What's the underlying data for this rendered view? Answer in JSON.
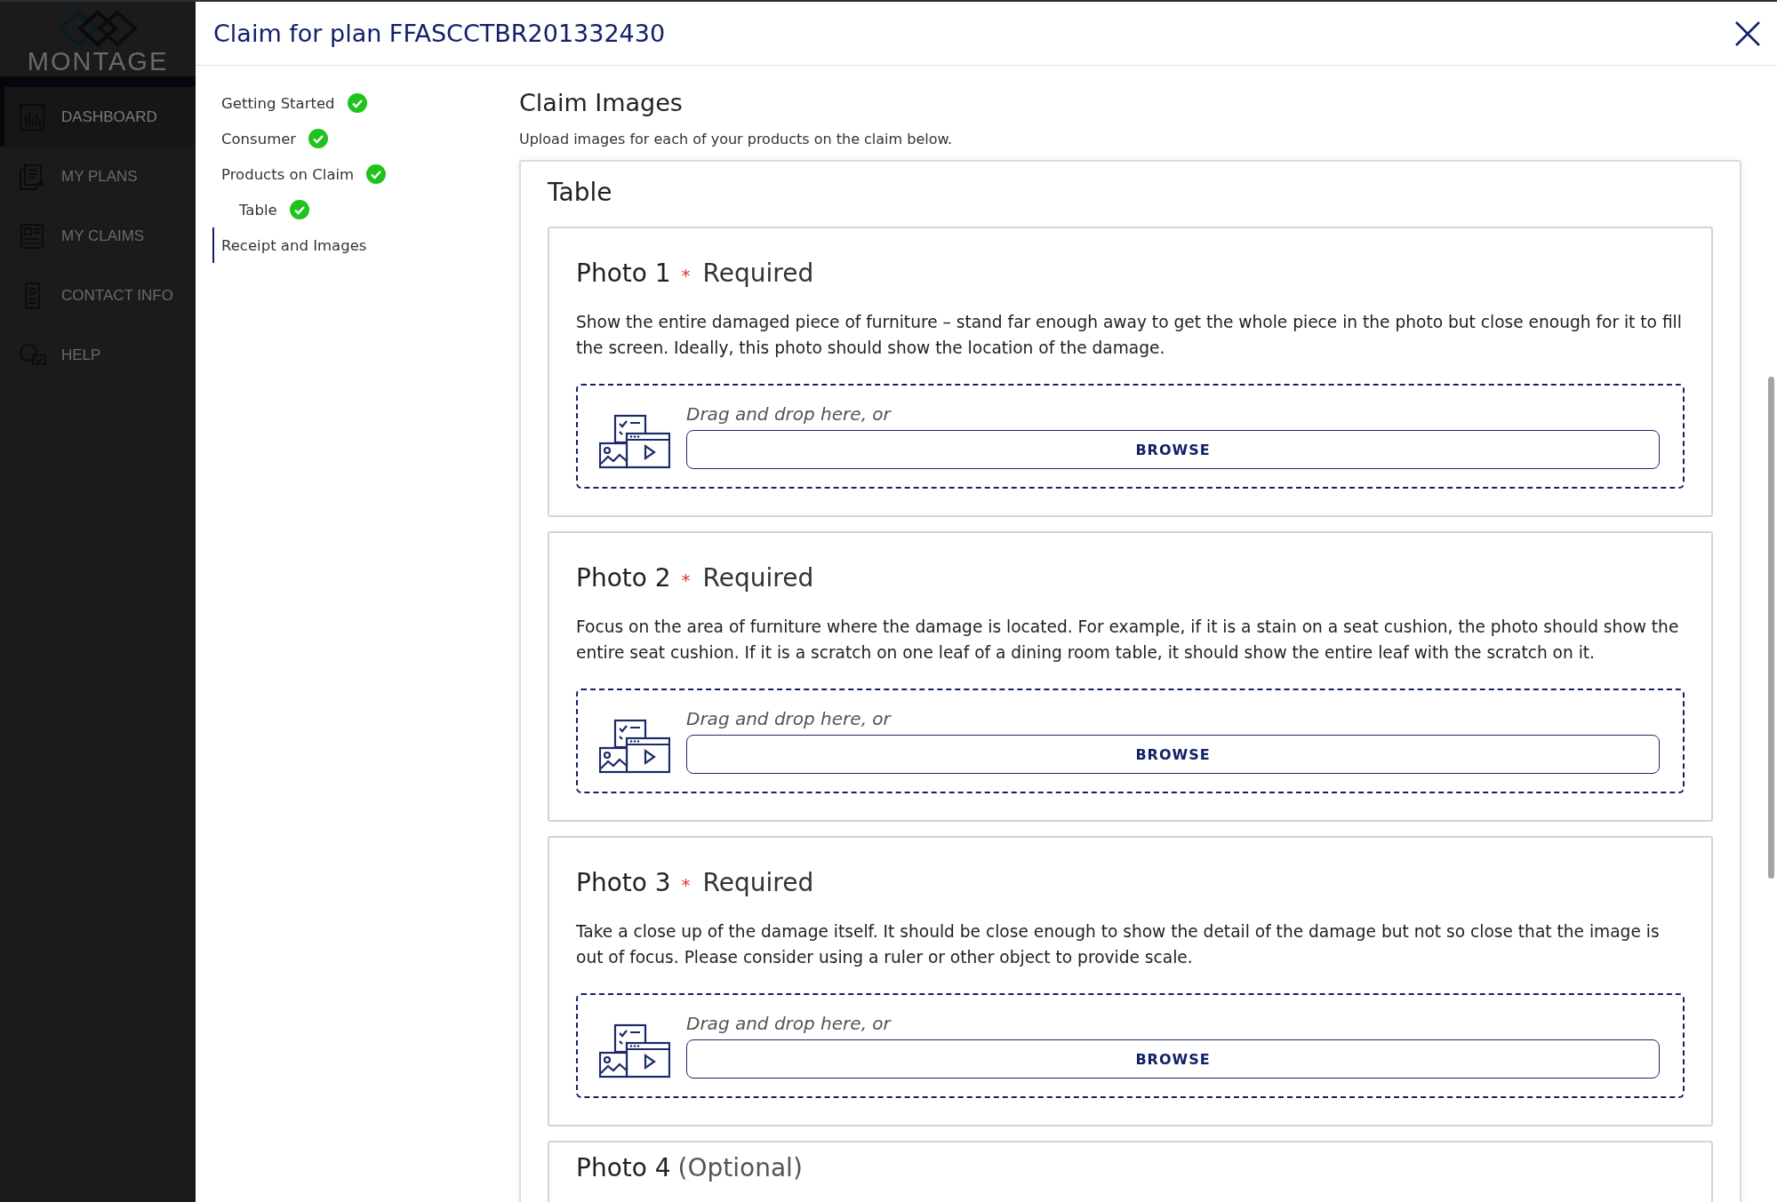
{
  "app_sidebar": {
    "logo": "MONTAGE",
    "items": [
      {
        "label": "DASHBOARD",
        "selected": true
      },
      {
        "label": "MY PLANS",
        "selected": false
      },
      {
        "label": "MY CLAIMS",
        "selected": false
      },
      {
        "label": "CONTACT INFO",
        "selected": false
      },
      {
        "label": "HELP",
        "selected": false
      }
    ]
  },
  "dialog": {
    "title": "Claim for plan FFASCCTBR201332430",
    "steps": [
      {
        "label": "Getting Started",
        "completed": true,
        "selected": false
      },
      {
        "label": "Consumer",
        "completed": true,
        "selected": false
      },
      {
        "label": "Products on Claim",
        "completed": true,
        "selected": false,
        "children": [
          {
            "label": "Table",
            "completed": true,
            "selected": false
          }
        ]
      },
      {
        "label": "Receipt and Images",
        "completed": false,
        "selected": true
      }
    ],
    "section": {
      "title": "Claim Images",
      "subtitle": "Upload images for each of your products on the claim below.",
      "product": "Table",
      "photos": [
        {
          "title": "Photo 1",
          "required": true,
          "required_mark": "*",
          "note": "Required",
          "description": "Show the entire damaged piece of furniture – stand far enough away to get the whole piece in the photo but close enough for it to fill the screen. Ideally, this photo should show the location of the damage.",
          "hint": "Drag and drop here, or",
          "button": "BROWSE"
        },
        {
          "title": "Photo 2",
          "required": true,
          "required_mark": "*",
          "note": "Required",
          "description": "Focus on the area of furniture where the damage is located. For example, if it is a stain on a seat cushion, the photo should show the entire seat cushion. If it is a scratch on one leaf of a dining room table, it should show the entire leaf with the scratch on it.",
          "hint": "Drag and drop here, or",
          "button": "BROWSE"
        },
        {
          "title": "Photo 3",
          "required": true,
          "required_mark": "*",
          "note": "Required",
          "description": "Take a close up of the damage itself. It should be close enough to show the detail of the damage but not so close that the image is out of focus. Please consider using a ruler or other object to provide scale.",
          "hint": "Drag and drop here, or",
          "button": "BROWSE"
        },
        {
          "title": "Photo 4",
          "required": false,
          "note": "(Optional)"
        }
      ]
    }
  }
}
